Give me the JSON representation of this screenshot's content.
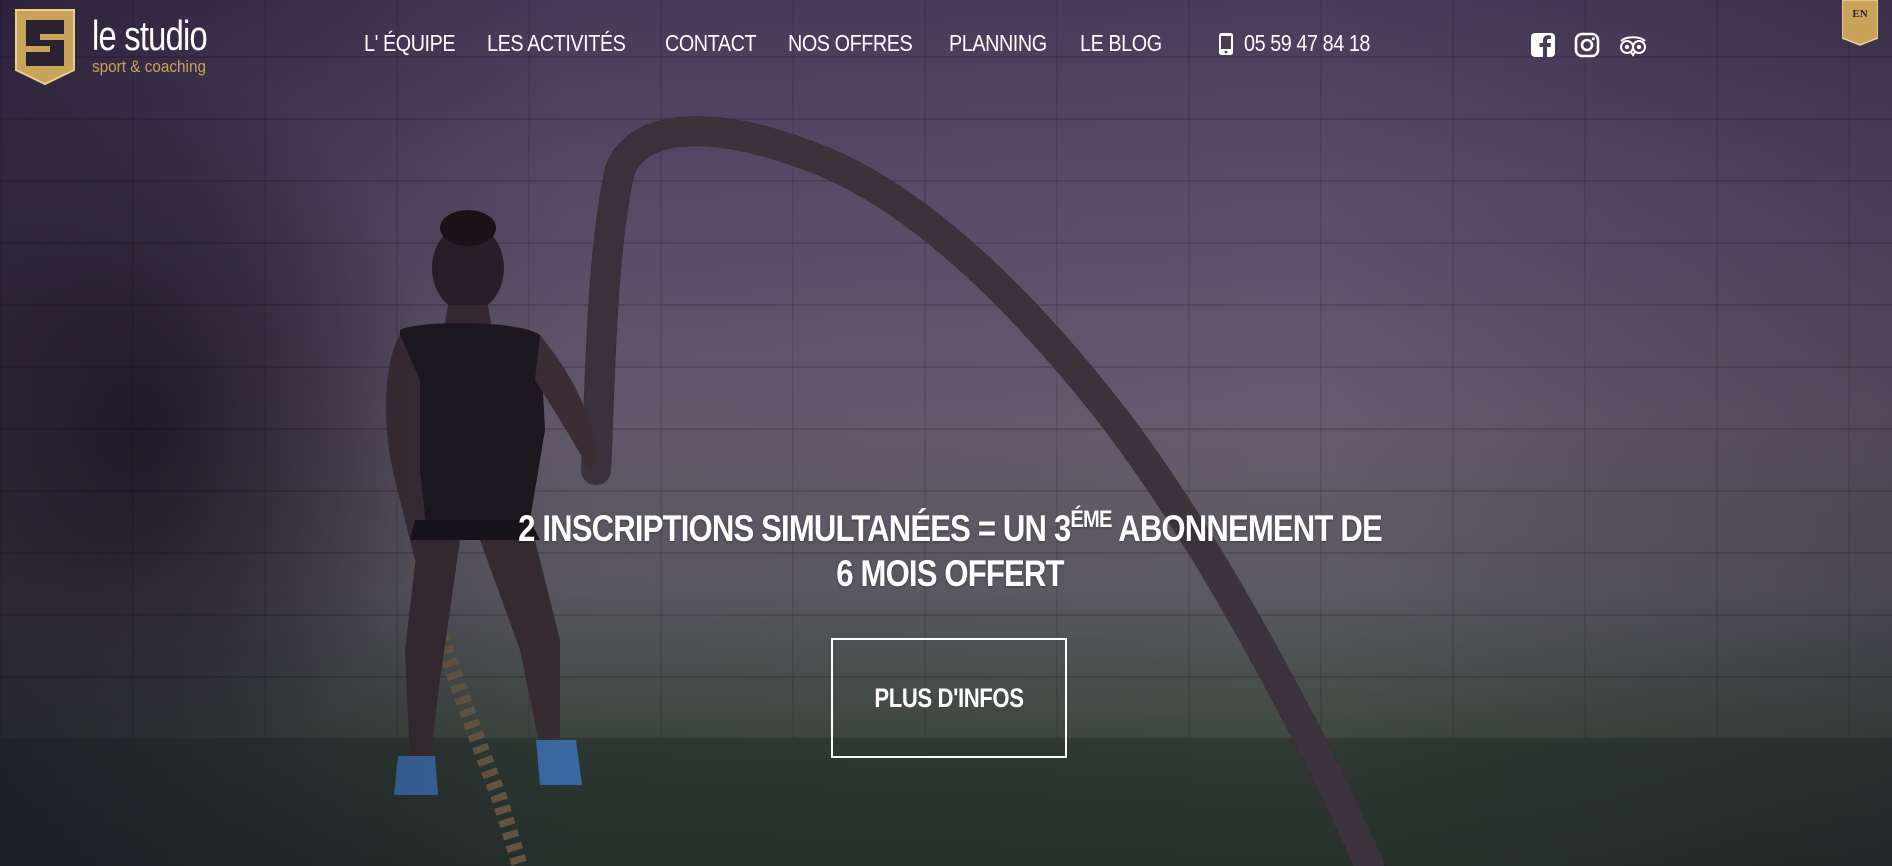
{
  "brand": {
    "name": "le studio",
    "tagline": "sport & coaching",
    "logo_letter": "S",
    "gold": "#c9a35a"
  },
  "nav": {
    "items": [
      {
        "label": "L' ÉQUIPE"
      },
      {
        "label": "LES ACTIVITÉS"
      },
      {
        "label": "CONTACT"
      },
      {
        "label": "NOS OFFRES"
      },
      {
        "label": "PLANNING"
      },
      {
        "label": "LE BLOG"
      }
    ]
  },
  "contact": {
    "phone": "05 59 47 84 18",
    "phone_icon": "mobile-phone-icon"
  },
  "socials": [
    {
      "icon": "facebook-icon"
    },
    {
      "icon": "instagram-icon"
    },
    {
      "icon": "tripadvisor-icon"
    }
  ],
  "language": {
    "current": "EN"
  },
  "hero": {
    "headline_part1": "2 INSCRIPTIONS SIMULTANÉES = UN 3",
    "headline_sup": "ÉME",
    "headline_part2": " ABONNEMENT DE 6 MOIS OFFERT",
    "cta_label": "PLUS D'INFOS"
  }
}
